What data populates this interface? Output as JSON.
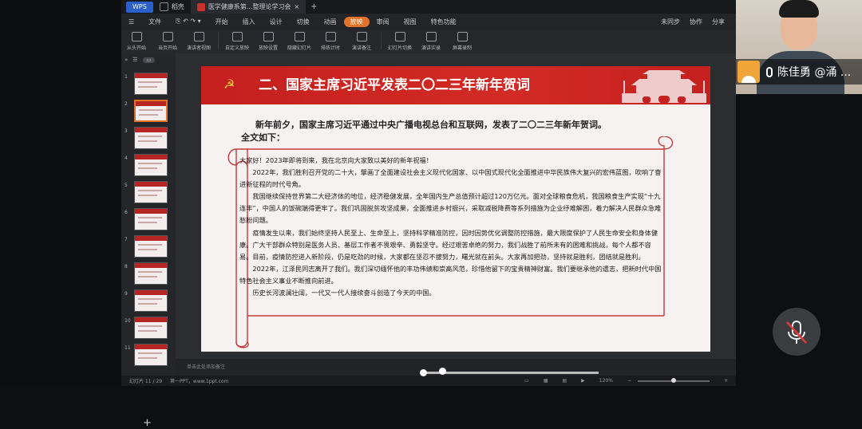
{
  "titlebar": {
    "app_badge": "WPS",
    "tabs": [
      {
        "label": "稻壳"
      },
      {
        "label": "医学健康系第...整理论学习会"
      }
    ]
  },
  "menubar": {
    "file": "文件",
    "items": [
      "开始",
      "插入",
      "设计",
      "切换",
      "动画",
      "放映",
      "审阅",
      "视图",
      "特色功能"
    ],
    "active": "放映",
    "right": [
      "未同步",
      "协作",
      "分享"
    ]
  },
  "ribbon": {
    "buttons": [
      "从头开始",
      "当页开始",
      "演讲者视图",
      "自定义放映",
      "放映设置",
      "隐藏幻灯片",
      "排练计时",
      "演讲备注",
      "幻灯片切换",
      "演讲实录",
      "屏幕录制"
    ]
  },
  "panel": {
    "slide_numbers": [
      "1",
      "2",
      "3",
      "4",
      "5",
      "6",
      "7",
      "8",
      "9",
      "10",
      "11"
    ],
    "selected_index": 1
  },
  "slide": {
    "title": "二、国家主席习近平发表二〇二三年新年贺词",
    "intro_line1": "新年前夕，国家主席习近平通过中央广播电视总台和互联网，发表了二〇二三年新年贺词。",
    "intro_line2": "全文如下：",
    "paragraphs": [
      "大家好！2023年即将到来，我在北京向大家致以美好的新年祝福！",
      "2022年，我们胜利召开党的二十大，擘画了全面建设社会主义现代化国家、以中国式现代化全面推进中华民族伟大复兴的宏伟蓝图，吹响了奋进新征程的时代号角。",
      "我国继续保持世界第二大经济体的地位，经济稳健发展，全年国内生产总值预计超过120万亿元。面对全球粮食危机，我国粮食生产实现“十九连丰”，中国人的饭碗端得更牢了。我们巩固脱贫攻坚成果，全面推进乡村振兴，采取减税降费等系列措施为企业纾难解困，着力解决人民群众急难愁盼问题。",
      "疫情发生以来，我们始终坚持人民至上、生命至上，坚持科学精准防控，因时因势优化调整防控措施，最大限度保护了人民生命安全和身体健康。广大干部群众特别是医务人员、基层工作者不畏艰辛、勇毅坚守。经过艰苦卓绝的努力，我们战胜了前所未有的困难和挑战，每个人都不容易。目前，疫情防控进入新阶段，仍是吃劲的时候，大家都在坚忍不拔努力，曙光就在前头。大家再加把劲，坚持就是胜利，团结就是胜利。",
      "2022年，江泽民同志离开了我们。我们深切缅怀他的丰功伟绩和崇高风范，珍惜他留下的宝贵精神财富。我们要继承他的遗志，把新时代中国特色社会主义事业不断推向前进。",
      "历史长河波澜壮阔，一代又一代人接续奋斗创造了今天的中国。"
    ]
  },
  "notes": {
    "placeholder": "单击此处添加备注"
  },
  "status": {
    "slide_counter": "幻灯片 11 / 29",
    "theme": "第一PPT，www.1ppt.com",
    "zoom": "120%",
    "zoom_fraction": 0.5
  },
  "webcam": {
    "name": "陈佳勇 @涌 ..."
  },
  "colors": {
    "accent": "#e2722a",
    "slide_red": "#c51f1f",
    "wps_blue": "#2b5fc9"
  }
}
